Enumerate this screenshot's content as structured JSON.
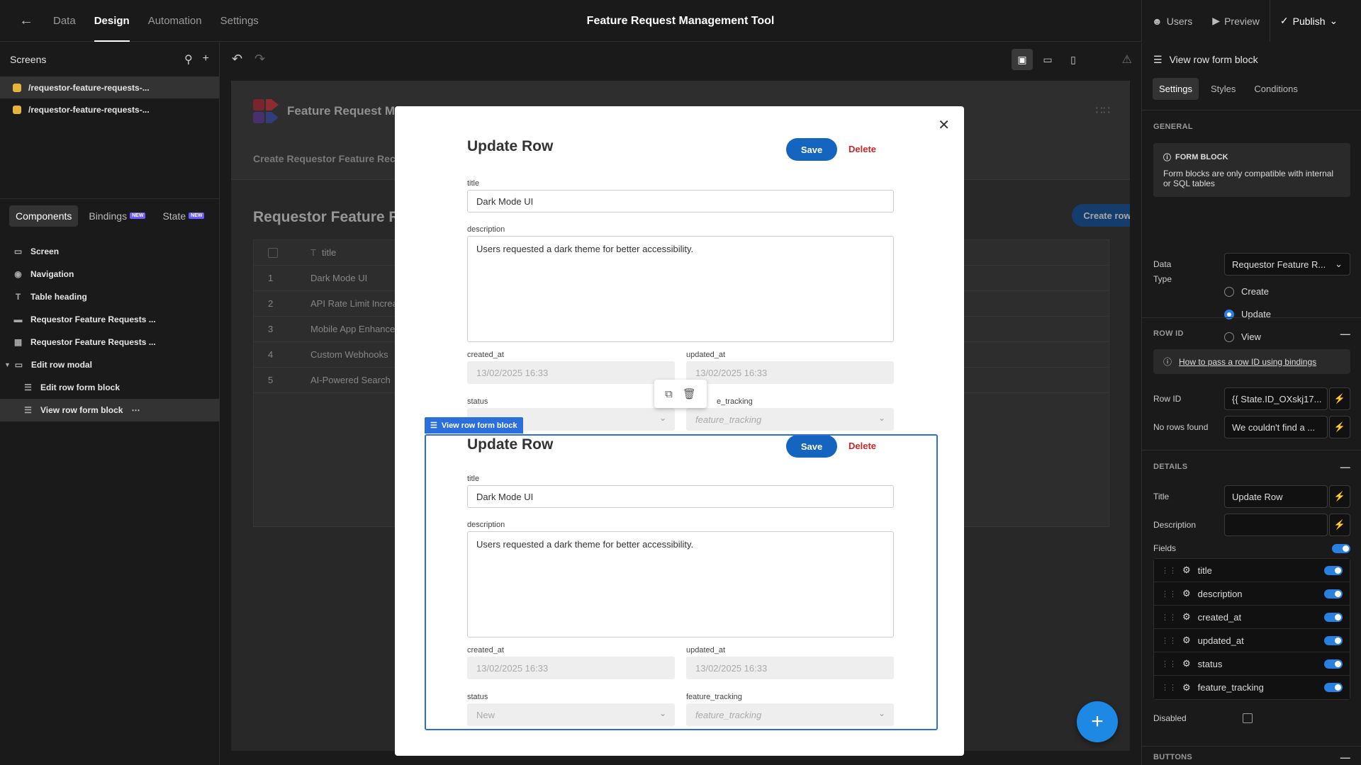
{
  "topbar": {
    "tabs": [
      "Data",
      "Design",
      "Automation",
      "Settings"
    ],
    "active_tab": "Design",
    "app_title": "Feature Request Management Tool",
    "users": "Users",
    "preview": "Preview",
    "publish": "Publish"
  },
  "left": {
    "screens_title": "Screens",
    "screens": [
      "/requestor-feature-requests-...",
      "/requestor-feature-requests-..."
    ],
    "tabs": {
      "components": "Components",
      "bindings": "Bindings",
      "state": "State",
      "new_badge": "NEW"
    },
    "tree": [
      {
        "label": "Screen",
        "icon": "screen-icon"
      },
      {
        "label": "Navigation",
        "icon": "eye-icon"
      },
      {
        "label": "Table heading",
        "icon": "text-icon"
      },
      {
        "label": "Requestor Feature Requests ...",
        "icon": "button-icon"
      },
      {
        "label": "Requestor Feature Requests ...",
        "icon": "table-icon"
      },
      {
        "label": "Edit row modal",
        "icon": "modal-icon"
      },
      {
        "label": "Edit row form block",
        "icon": "form-icon"
      },
      {
        "label": "View row form block",
        "icon": "form-icon"
      }
    ]
  },
  "canvas": {
    "app_name": "Feature Request Ma",
    "nav_link": "Create Requestor Feature Rec",
    "heading": "Requestor Feature Re",
    "create_row": "Create row",
    "table": {
      "column": "title",
      "rows": [
        {
          "n": "1",
          "title": "Dark Mode UI"
        },
        {
          "n": "2",
          "title": "API Rate Limit Increa"
        },
        {
          "n": "3",
          "title": "Mobile App Enhance"
        },
        {
          "n": "4",
          "title": "Custom Webhooks"
        },
        {
          "n": "5",
          "title": "AI-Powered Search"
        }
      ]
    }
  },
  "form": {
    "title": "Update Row",
    "save": "Save",
    "delete": "Delete",
    "labels": {
      "title": "title",
      "description": "description",
      "created_at": "created_at",
      "updated_at": "updated_at",
      "status": "status",
      "feature_tracking": "feature_tracking"
    },
    "values": {
      "title": "Dark Mode UI",
      "description": "Users requested a dark theme for better accessibility.",
      "created_at": "13/02/2025 16:33",
      "updated_at": "13/02/2025 16:33",
      "status": "New",
      "feature_tracking": "feature_tracking"
    },
    "top_partial_label": "e_tracking",
    "selection_label": "View row form block"
  },
  "right": {
    "title": "View row form block",
    "tabs": [
      "Settings",
      "Styles",
      "Conditions"
    ],
    "general": {
      "header": "GENERAL",
      "info_title": "FORM BLOCK",
      "info_text": "Form blocks are only compatible with internal or SQL tables",
      "data_label": "Data",
      "data_value": "Requestor Feature R...",
      "type_label": "Type",
      "types": [
        "Create",
        "Update",
        "View"
      ],
      "selected_type": "Update"
    },
    "rowid": {
      "header": "ROW ID",
      "help": "How to pass a row ID using bindings",
      "row_id_label": "Row ID",
      "row_id_value": "{{ State.ID_OXskj17...",
      "no_rows_label": "No rows found",
      "no_rows_value": "We couldn't find a ..."
    },
    "details": {
      "header": "DETAILS",
      "title_label": "Title",
      "title_value": "Update Row",
      "description_label": "Description",
      "description_value": "",
      "fields_label": "Fields",
      "fields": [
        "title",
        "description",
        "created_at",
        "updated_at",
        "status",
        "feature_tracking"
      ],
      "disabled_label": "Disabled"
    },
    "buttons_header": "BUTTONS"
  },
  "colors": {
    "accent": "#1565c0",
    "delete": "#c62828",
    "selection": "#2a6fdb",
    "fab": "#1e88e5"
  }
}
